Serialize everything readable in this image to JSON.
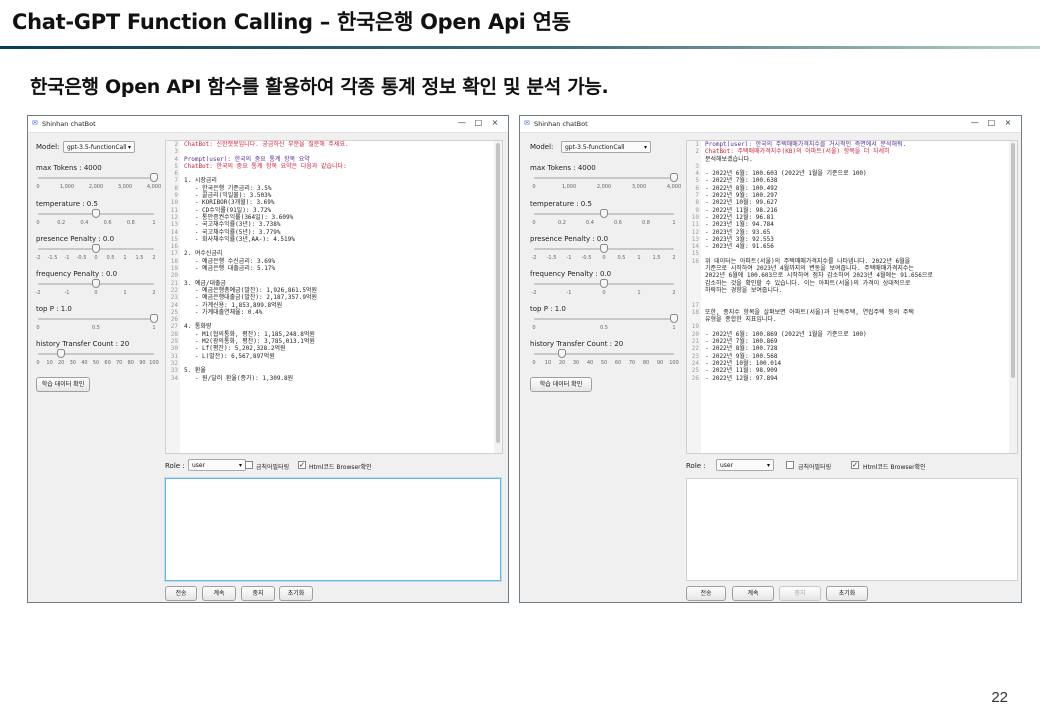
{
  "slide": {
    "title": "Chat-GPT Function Calling – 한국은행 Open Api 연동",
    "subtitle": "한국은행 Open API 함수를 활용하여 각종 통계 정보 확인 및 분석 가능.",
    "page_number": "22"
  },
  "left_window": {
    "title": "Shinhan chatBot",
    "controls": {
      "minimize": "—",
      "maximize": "□",
      "close": "×"
    },
    "model_label": "Model:",
    "model_value": "gpt-3.5-functionCall",
    "max_tokens_label": "max Tokens : 4000",
    "max_tokens_ticks": [
      "0",
      "1,000",
      "2,000",
      "3,000",
      "4,000"
    ],
    "max_tokens_value": 1.0,
    "temperature_label": "temperature : 0.5",
    "temperature_ticks": [
      "0",
      "0.2",
      "0.4",
      "0.6",
      "0.8",
      "1"
    ],
    "temperature_value": 0.5,
    "presence_label": "presence Penalty : 0.0",
    "presence_ticks": [
      "-2",
      "-1.5",
      "-1",
      "-0.5",
      "0",
      "0.5",
      "1",
      "1.5",
      "2"
    ],
    "presence_value": 0.5,
    "frequency_label": "frequency Penalty : 0.0",
    "frequency_ticks": [
      "-2",
      "-1",
      "0",
      "1",
      "2"
    ],
    "frequency_value": 0.5,
    "top_p_label": "top P : 1.0",
    "top_p_ticks": [
      "0",
      "0.5",
      "1"
    ],
    "top_p_value": 1.0,
    "history_label": "history Transfer Count : 20",
    "history_ticks": [
      "0",
      "10",
      "20",
      "30",
      "40",
      "50",
      "60",
      "70",
      "80",
      "90",
      "100"
    ],
    "history_value": 0.2,
    "learn_button": "학습 데이터 확인",
    "line_numbers": [
      "2",
      "3",
      "4",
      "5",
      "6",
      "7",
      "8",
      "9",
      "10",
      "11",
      "12",
      "13",
      "14",
      "15",
      "16",
      "17",
      "18",
      "19",
      "20",
      "21",
      "22",
      "23",
      "24",
      "25",
      "26",
      "27",
      "28",
      "29",
      "30",
      "31",
      "32",
      "33",
      "34"
    ],
    "lines": [
      {
        "t": "ChatBot: 신한챗봇입니다. 궁금하신 부분을 질문해 주세요.",
        "c": "red"
      },
      {
        "t": "",
        "c": ""
      },
      {
        "t": "Prompt(user): 한국의 중요 통계 항목 요약",
        "c": "purple"
      },
      {
        "t": "ChatBot: 한국의 중요 통계 항목 요약은 다음과 같습니다:",
        "c": "red"
      },
      {
        "t": "",
        "c": ""
      },
      {
        "t": "1. 시장금리",
        "c": ""
      },
      {
        "t": "   - 한국은행 기준금리: 3.5%",
        "c": ""
      },
      {
        "t": "   - 콜금리(익일물): 3.503%",
        "c": ""
      },
      {
        "t": "   - KORIBOR(3개월): 3.69%",
        "c": ""
      },
      {
        "t": "   - CD수익률(91일): 3.72%",
        "c": ""
      },
      {
        "t": "   - 통안증권수익률(364일): 3.609%",
        "c": ""
      },
      {
        "t": "   - 국고채수익률(3년): 3.738%",
        "c": ""
      },
      {
        "t": "   - 국고채수익률(5년): 3.779%",
        "c": ""
      },
      {
        "t": "   - 회사채수익률(3년,AA-): 4.519%",
        "c": ""
      },
      {
        "t": "",
        "c": ""
      },
      {
        "t": "2. 여수신금리",
        "c": ""
      },
      {
        "t": "   - 예금은행 수신금리: 3.69%",
        "c": ""
      },
      {
        "t": "   - 예금은행 대출금리: 5.17%",
        "c": ""
      },
      {
        "t": "",
        "c": ""
      },
      {
        "t": "3. 예금/대출금",
        "c": ""
      },
      {
        "t": "   - 예금은행총예금(말잔): 1,926,861.5억원",
        "c": ""
      },
      {
        "t": "   - 예금은행대출금(말잔): 2,187,357.9억원",
        "c": ""
      },
      {
        "t": "   - 가계신용: 1,853,899.8억원",
        "c": ""
      },
      {
        "t": "   - 가계대출연체율: 0.4%",
        "c": ""
      },
      {
        "t": "",
        "c": ""
      },
      {
        "t": "4. 통화량",
        "c": ""
      },
      {
        "t": "   - M1(협의통화, 평잔): 1,185,248.8억원",
        "c": ""
      },
      {
        "t": "   - M2(광의통화, 평잔): 3,785,013.1억원",
        "c": ""
      },
      {
        "t": "   - Lf(평잔): 5,202,328.2억원",
        "c": ""
      },
      {
        "t": "   - L(말잔): 6,567,897억원",
        "c": ""
      },
      {
        "t": "",
        "c": ""
      },
      {
        "t": "5. 환율",
        "c": ""
      },
      {
        "t": "   - 원/달러 환율(종가): 1,309.8원",
        "c": ""
      }
    ],
    "role_label": "Role :",
    "role_value": "user",
    "check1_label": "금칙어필터링",
    "check1": false,
    "check2_label": "Html코드 Browser확인",
    "check2": true,
    "buttons": {
      "send": "전송",
      "continue": "계속",
      "stop": "중지",
      "reset": "초기화"
    },
    "stop_disabled": false
  },
  "right_window": {
    "title": "Shinhan chatBot",
    "controls": {
      "minimize": "—",
      "maximize": "□",
      "close": "×"
    },
    "model_label": "Model:",
    "model_value": "gpt-3.5-functionCall",
    "max_tokens_label": "max Tokens : 4000",
    "max_tokens_ticks": [
      "0",
      "1,000",
      "2,000",
      "3,000",
      "4,000"
    ],
    "max_tokens_value": 1.0,
    "temperature_label": "temperature : 0.5",
    "temperature_ticks": [
      "0",
      "0.2",
      "0.4",
      "0.6",
      "0.8",
      "1"
    ],
    "temperature_value": 0.5,
    "presence_label": "presence Penalty : 0.0",
    "presence_ticks": [
      "-2",
      "-1.5",
      "-1",
      "-0.5",
      "0",
      "0.5",
      "1",
      "1.5",
      "2"
    ],
    "presence_value": 0.5,
    "frequency_label": "frequency Penalty : 0.0",
    "frequency_ticks": [
      "-2",
      "-1",
      "0",
      "1",
      "2"
    ],
    "frequency_value": 0.5,
    "top_p_label": "top P : 1.0",
    "top_p_ticks": [
      "0",
      "0.5",
      "1"
    ],
    "top_p_value": 1.0,
    "history_label": "history Transfer Count : 20",
    "history_ticks": [
      "0",
      "10",
      "20",
      "30",
      "40",
      "50",
      "60",
      "70",
      "80",
      "90",
      "100"
    ],
    "history_value": 0.2,
    "learn_button": "학습 데이터 확인",
    "line_numbers": [
      "1",
      "2",
      "",
      "3",
      "4",
      "5",
      "6",
      "7",
      "8",
      "9",
      "10",
      "11",
      "12",
      "13",
      "14",
      "15",
      "16",
      "",
      "",
      "",
      "",
      "",
      "17",
      "18",
      "",
      "19",
      "20",
      "21",
      "22",
      "23",
      "24",
      "25",
      "26"
    ],
    "lines": [
      {
        "t": "Prompt(user): 한국의 주택매매가격지수를 거시적인 측면에서 분석해줘.",
        "c": "purple"
      },
      {
        "t": "ChatBot: 주택매매가격지수(KB)의 아파트(서울) 항목을 더 자세히",
        "c": "red"
      },
      {
        "t": "분석해보겠습니다.",
        "c": ""
      },
      {
        "t": "",
        "c": ""
      },
      {
        "t": "- 2022년 6월: 100.603 (2022년 1월을 기준으로 100)",
        "c": ""
      },
      {
        "t": "- 2022년 7월: 100.638",
        "c": ""
      },
      {
        "t": "- 2022년 8월: 100.492",
        "c": ""
      },
      {
        "t": "- 2022년 9월: 100.297",
        "c": ""
      },
      {
        "t": "- 2022년 10월: 99.627",
        "c": ""
      },
      {
        "t": "- 2022년 11월: 98.216",
        "c": ""
      },
      {
        "t": "- 2022년 12월: 96.81",
        "c": ""
      },
      {
        "t": "- 2023년 1월: 94.784",
        "c": ""
      },
      {
        "t": "- 2023년 2월: 93.65",
        "c": ""
      },
      {
        "t": "- 2023년 3월: 92.553",
        "c": ""
      },
      {
        "t": "- 2023년 4월: 91.656",
        "c": ""
      },
      {
        "t": "",
        "c": ""
      },
      {
        "t": "위 데이터는 아파트(서울)의 주택매매가격지수를 나타냅니다. 2022년 6월을",
        "c": ""
      },
      {
        "t": "기준으로 시작하여 2023년 4월까지의 변동을 보여줍니다. 주택매매가격지수는",
        "c": ""
      },
      {
        "t": "2022년 6월에 100.603으로 시작하여 점차 감소하여 2023년 4월에는 91.656으로",
        "c": ""
      },
      {
        "t": "감소하는 것을 확인할 수 있습니다. 이는 아파트(서울)의 가격이 상대적으로",
        "c": ""
      },
      {
        "t": "하락하는 경향을 보여줍니다.",
        "c": ""
      },
      {
        "t": "",
        "c": ""
      },
      {
        "t": "",
        "c": ""
      },
      {
        "t": "또한, 종지수 항목을 살펴보면 아파트(서울)과 단독주택, 연립주택 등의 주택",
        "c": ""
      },
      {
        "t": "유형을 종합한 지표입니다.",
        "c": ""
      },
      {
        "t": "",
        "c": ""
      },
      {
        "t": "- 2022년 6월: 100.869 (2022년 1월을 기준으로 100)",
        "c": ""
      },
      {
        "t": "- 2022년 7월: 100.869",
        "c": ""
      },
      {
        "t": "- 2022년 8월: 100.728",
        "c": ""
      },
      {
        "t": "- 2022년 9월: 100.568",
        "c": ""
      },
      {
        "t": "- 2022년 10월: 100.014",
        "c": ""
      },
      {
        "t": "- 2022년 11월: 98.909",
        "c": ""
      },
      {
        "t": "- 2022년 12월: 97.894",
        "c": ""
      }
    ],
    "role_label": "Role :",
    "role_value": "user",
    "check1_label": "금칙어필터링",
    "check1": false,
    "check2_label": "Html코드 Browser확인",
    "check2": true,
    "buttons": {
      "send": "전송",
      "continue": "계속",
      "stop": "중지",
      "reset": "초기화"
    },
    "stop_disabled": true
  }
}
